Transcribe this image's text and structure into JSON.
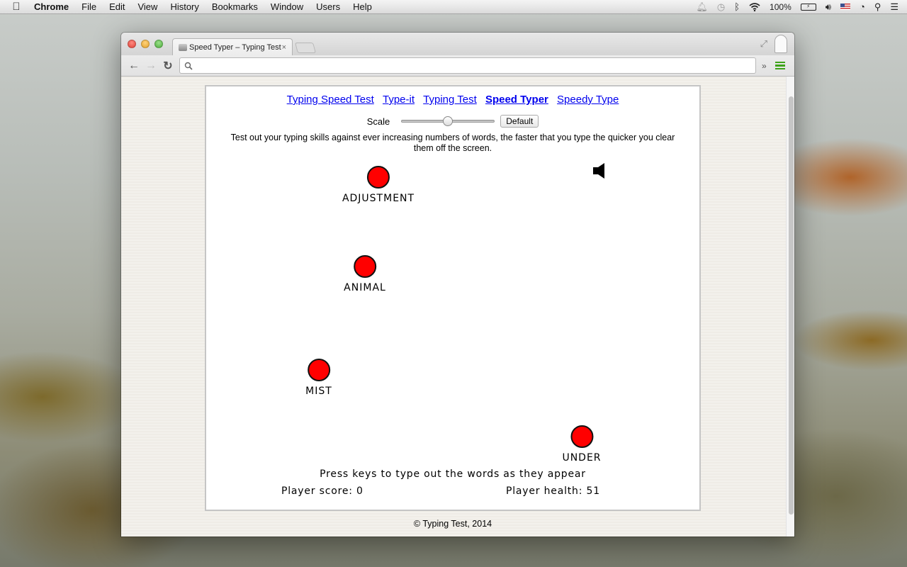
{
  "menubar": {
    "apple_icon": "apple-icon",
    "app_name": "Chrome",
    "items": [
      "File",
      "Edit",
      "View",
      "History",
      "Bookmarks",
      "Window",
      "Users",
      "Help"
    ],
    "status": {
      "battery_percent": "100%",
      "icons": [
        "notification-bell-icon",
        "time-machine-icon",
        "bluetooth-icon",
        "wifi-icon",
        "battery-icon",
        "volume-icon",
        "us-flag-icon",
        "clock-icon",
        "spotlight-search-icon",
        "notification-center-icon"
      ]
    }
  },
  "browser": {
    "tab_title": "Speed Typer – Typing Test",
    "tab_close": "×",
    "address_value": "",
    "extensions_more": "»"
  },
  "page": {
    "nav_links": [
      {
        "label": "Typing Speed Test",
        "active": false
      },
      {
        "label": "Type-it",
        "active": false
      },
      {
        "label": "Typing Test",
        "active": false
      },
      {
        "label": "Speed Typer",
        "active": true
      },
      {
        "label": "Speedy Type",
        "active": false
      }
    ],
    "scale_label": "Scale",
    "scale_value": 0.5,
    "default_button": "Default",
    "description": "Test out your typing skills against ever increasing numbers of words, the faster that you type the quicker you clear them off the screen.",
    "game": {
      "dot_color": "#ff0000",
      "words": [
        "ADJUSTMENT",
        "ANIMAL",
        "MIST",
        "UNDER"
      ],
      "sound_icon": "speaker-icon"
    },
    "hint": "Press keys to type out the words as they appear",
    "score_label": "Player score: 0",
    "score": 0,
    "health_label": "Player health: 51",
    "health": 51,
    "footer": "© Typing Test, 2014"
  }
}
